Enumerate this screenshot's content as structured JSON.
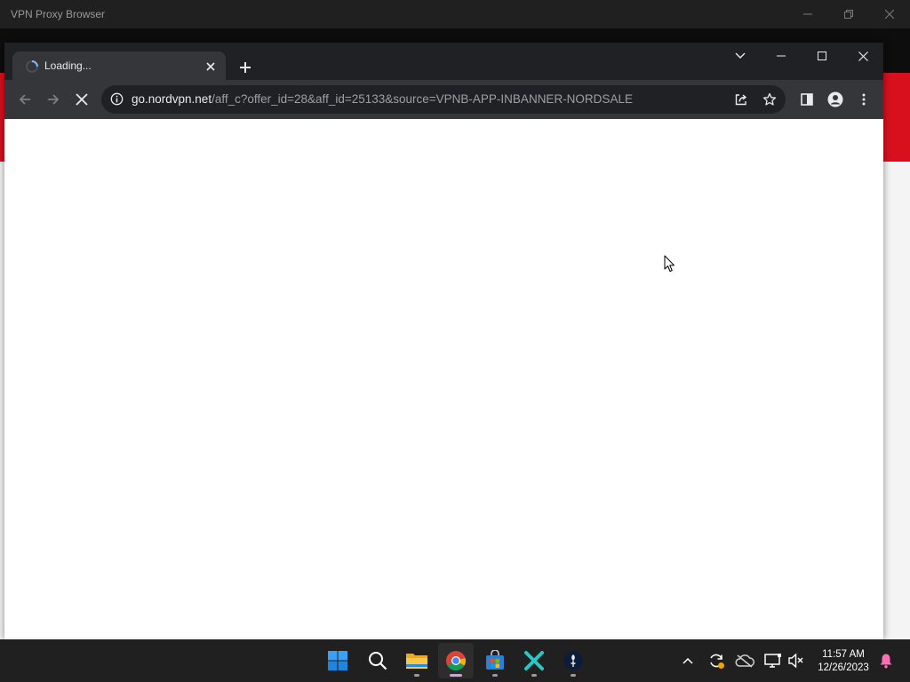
{
  "background_app": {
    "title": "VPN Proxy Browser"
  },
  "browser": {
    "tab": {
      "title": "Loading..."
    },
    "address": {
      "domain": "go.nordvpn.net",
      "path": "/aff_c?offer_id=28&aff_id=25133&source=VPNB-APP-INBANNER-NORDSALE"
    }
  },
  "taskbar": {
    "apps": [
      "start-icon",
      "search-icon",
      "file-explorer-icon",
      "chrome-icon",
      "microsoft-store-icon",
      "x-app-icon",
      "vpn-app-icon"
    ],
    "time": "11:57 AM",
    "date": "12/26/2023"
  },
  "colors": {
    "bg_red_banner": "#d8101e",
    "accent_indicator": "#c9a1e6"
  }
}
